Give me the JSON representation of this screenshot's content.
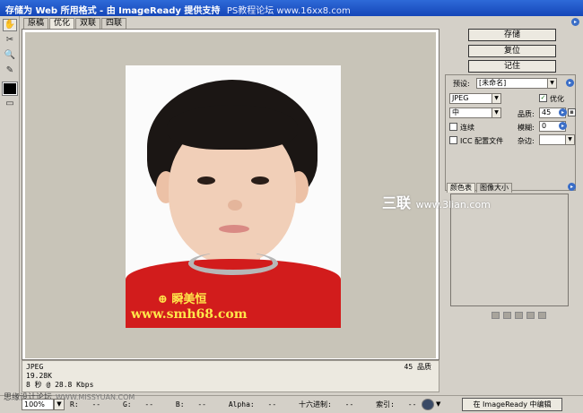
{
  "window": {
    "title": "存储为 Web 所用格式 - 由 ImageReady 提供支持",
    "watermark": "PS教程论坛 www.16xx8.com"
  },
  "tabs": [
    "原稿",
    "优化",
    "双联",
    "四联"
  ],
  "active_tab": 1,
  "photo": {
    "logo_text": "瞬美恒",
    "url_text": "www.smh68.com"
  },
  "info": {
    "format": "JPEG",
    "size": "19.28K",
    "time": "8 秒 @ 28.8 Kbps",
    "quality": "45 品质"
  },
  "statusbar": {
    "watermark": "思缘设计论坛",
    "watermark_site": "WWW.MISSYUAN.COM",
    "zoom": "100%",
    "r_label": "R:",
    "r_value": "--",
    "g_label": "G:",
    "g_value": "--",
    "b_label": "B:",
    "b_value": "--",
    "alpha_label": "Alpha:",
    "alpha_value": "--",
    "hex_label": "十六进制:",
    "hex_value": "--",
    "index_label": "索引:",
    "index_value": "--",
    "edit_button": "在 ImageReady 中编辑"
  },
  "right_panel": {
    "save_button": "存储",
    "reset_button": "复位",
    "remember_button": "记住",
    "preset_label": "预设:",
    "preset_value": "[未命名]",
    "format_value": "JPEG",
    "optimize_label": "优化",
    "quality_level": "中",
    "quality_label": "品质:",
    "quality_value": "45",
    "progressive_label": "连续",
    "blur_label": "模糊:",
    "blur_value": "0",
    "icc_label": "ICC 配置文件",
    "matte_label": "杂边:",
    "color_table_tab": "颜色表",
    "image_size_tab": "图像大小",
    "brand_mark": "三联",
    "brand_site": "www.3lian.com"
  }
}
